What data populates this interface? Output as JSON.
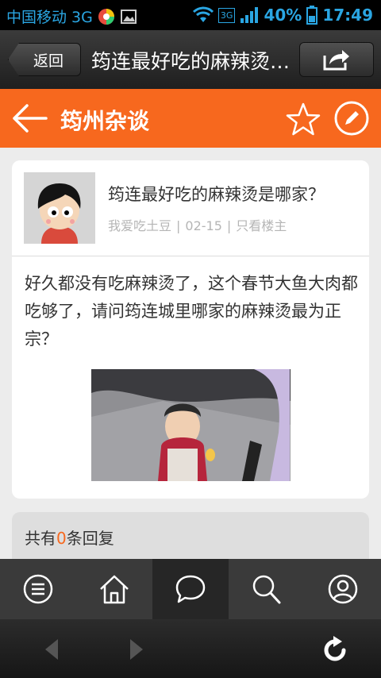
{
  "status_bar": {
    "carrier": "中国移动 3G",
    "network": "3G",
    "battery": "40%",
    "time": "17:49"
  },
  "browser": {
    "back_label": "返回",
    "page_title": "筠连最好吃的麻辣烫是哪家？",
    "share_icon": "share-icon",
    "refresh_icon": "refresh-icon"
  },
  "forum": {
    "name": "筠州杂谈",
    "accent": "#f7681e"
  },
  "post": {
    "title": "筠连最好吃的麻辣烫是哪家？",
    "author": "我爱吃土豆",
    "date": "02-15",
    "only_op": "只看楼主",
    "body": "好久都没有吃麻辣烫了，这个春节大鱼大肉都吃够了，请问筠连城里哪家的麻辣烫最为正宗？"
  },
  "replies": {
    "prefix": "共有",
    "count": "0",
    "suffix": "条回复"
  },
  "nav": [
    "menu-icon",
    "home-icon",
    "chat-icon",
    "search-icon",
    "profile-icon"
  ]
}
